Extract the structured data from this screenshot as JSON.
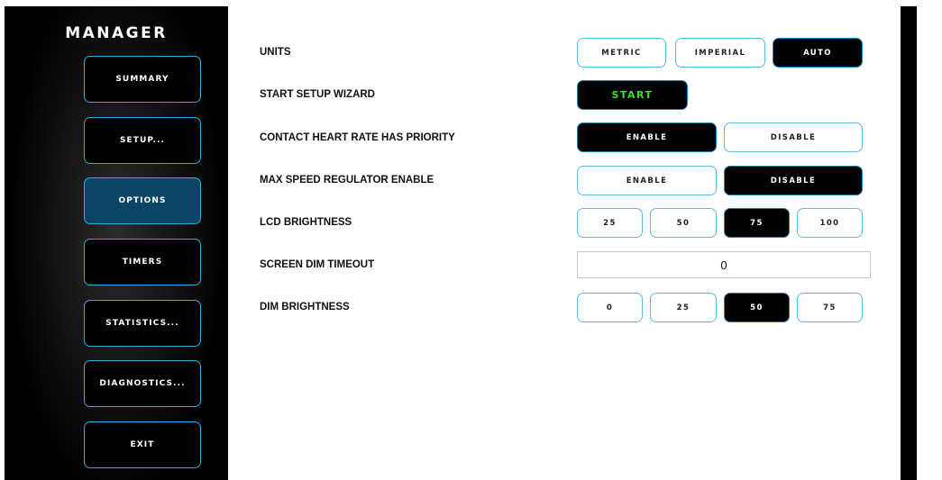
{
  "sidebar": {
    "title": "MANAGER",
    "items": [
      {
        "label": "SUMMARY",
        "name": "nav-summary-button",
        "active": false
      },
      {
        "label": "SETUP...",
        "name": "nav-setup-button",
        "active": false
      },
      {
        "label": "OPTIONS",
        "name": "nav-options-button",
        "active": true
      },
      {
        "label": "TIMERS",
        "name": "nav-timers-button",
        "active": false
      },
      {
        "label": "STATISTICS...",
        "name": "nav-statistics-button",
        "active": false
      },
      {
        "label": "DIAGNOSTICS...",
        "name": "nav-diagnostics-button",
        "active": false
      },
      {
        "label": "EXIT",
        "name": "nav-exit-button",
        "active": false
      }
    ]
  },
  "options": {
    "units": {
      "label": "UNITS",
      "choices": [
        "METRIC",
        "IMPERIAL",
        "AUTO"
      ],
      "selected": "AUTO"
    },
    "setup_wizard": {
      "label": "START SETUP WIZARD",
      "button": "START"
    },
    "contact_hr_priority": {
      "label": "CONTACT HEART RATE HAS PRIORITY",
      "choices": [
        "ENABLE",
        "DISABLE"
      ],
      "selected": "ENABLE"
    },
    "max_speed_regulator": {
      "label": "MAX SPEED REGULATOR ENABLE",
      "choices": [
        "ENABLE",
        "DISABLE"
      ],
      "selected": "DISABLE"
    },
    "lcd_brightness": {
      "label": "LCD BRIGHTNESS",
      "choices": [
        "25",
        "50",
        "75",
        "100"
      ],
      "selected": "75"
    },
    "screen_dim_timeout": {
      "label": "SCREEN DIM TIMEOUT",
      "value": "0"
    },
    "dim_brightness": {
      "label": "DIM BRIGHTNESS",
      "choices": [
        "0",
        "25",
        "50",
        "75"
      ],
      "selected": "50"
    }
  },
  "colors": {
    "accent_border": "#33aadd",
    "active_nav": "#0b4565",
    "start_text": "#3ddc2f",
    "selected_bg": "#000000"
  }
}
